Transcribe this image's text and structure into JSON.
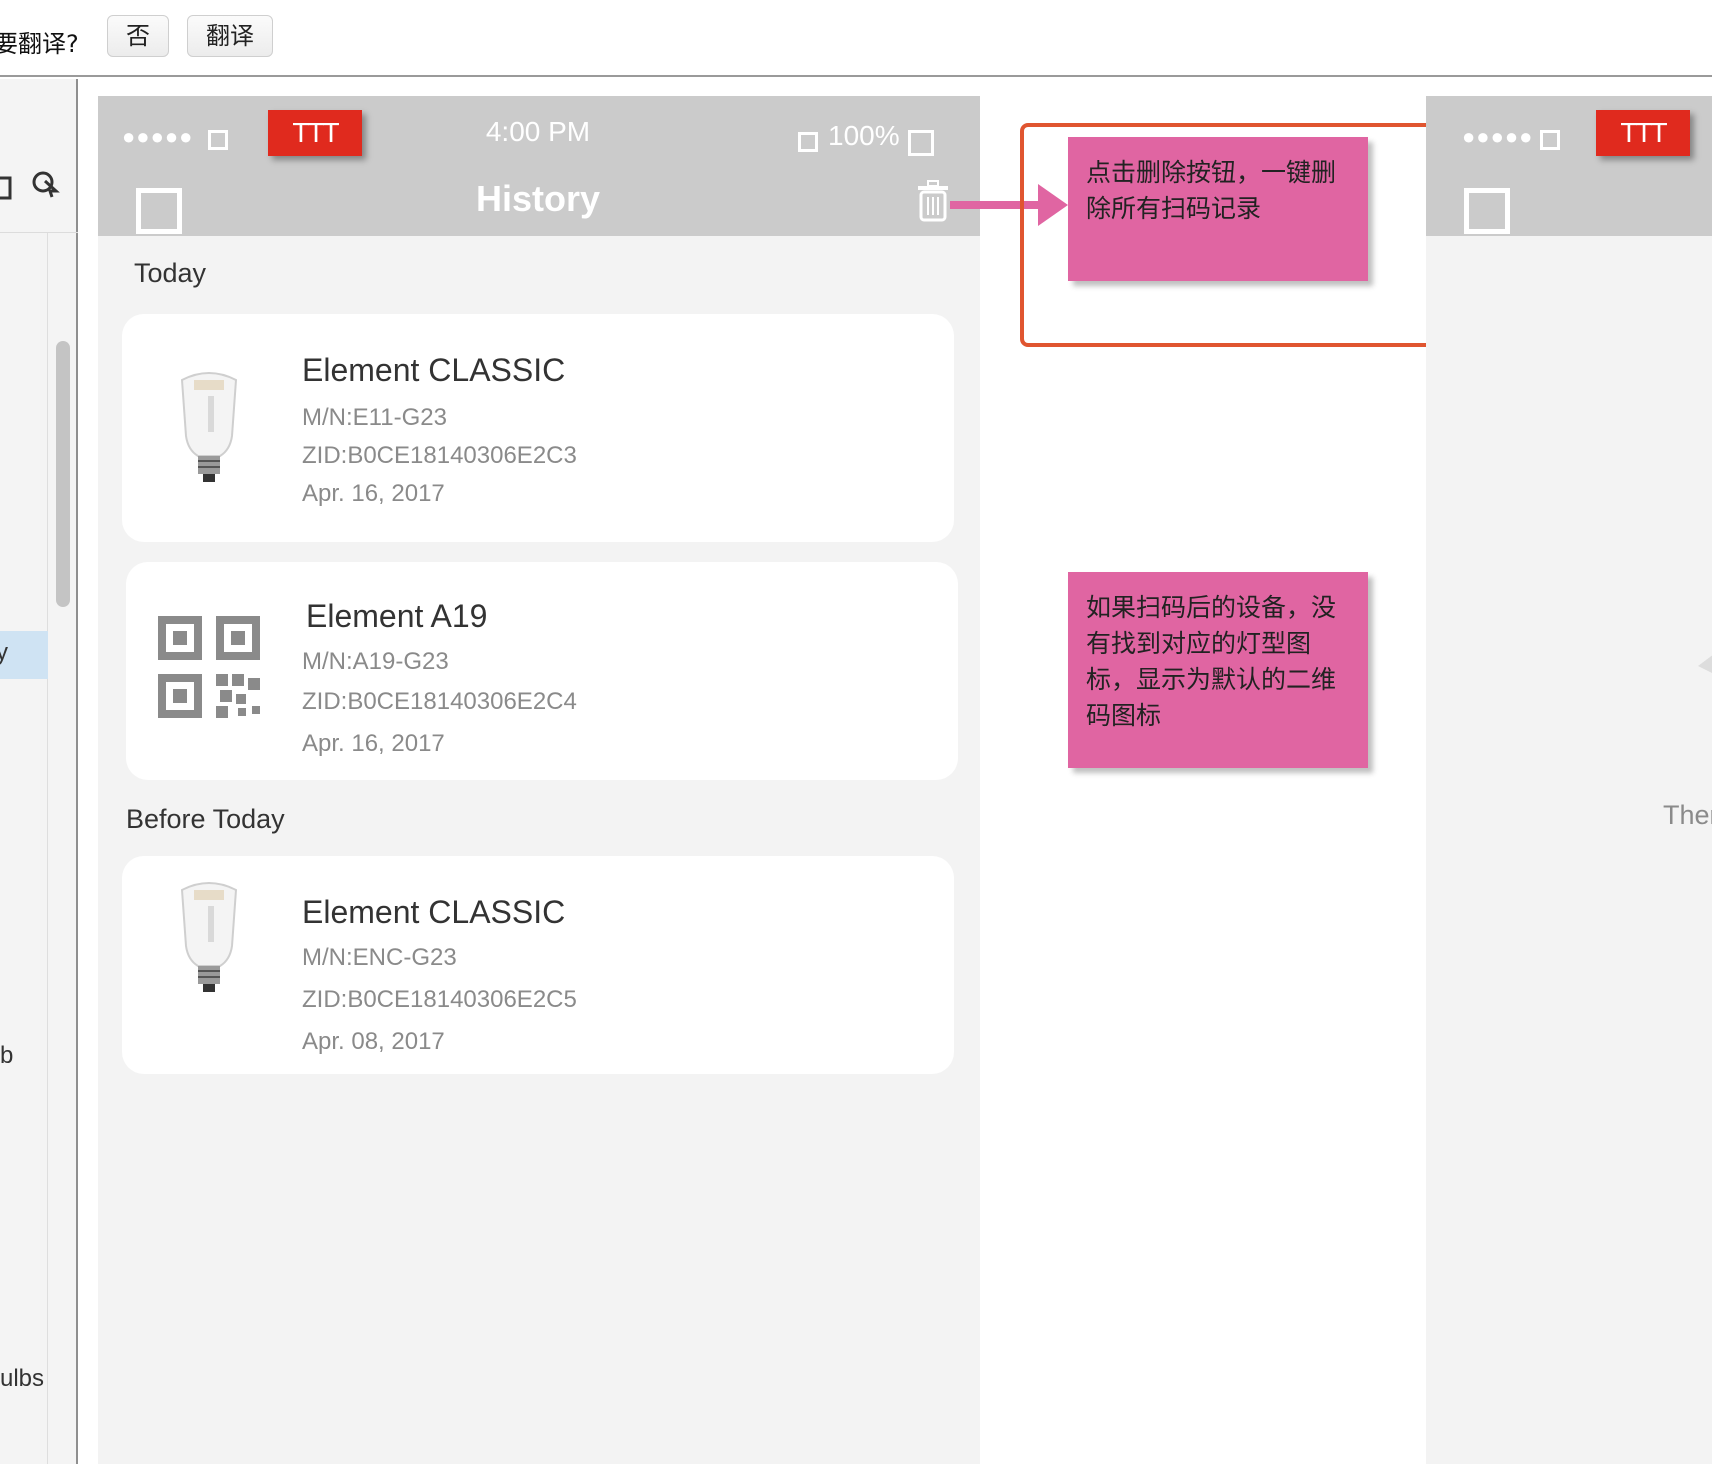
{
  "topbar": {
    "prompt": "要翻译?",
    "no_button": "否",
    "translate_button": "翻译"
  },
  "sidebar": {
    "selected_fragment": "y",
    "fragment_b": "b",
    "fragment_ulbs": "ulbs"
  },
  "phone": {
    "status": {
      "signal": "●●●●●",
      "carrier": "TTT",
      "time": "4:00 PM",
      "battery": "100%"
    },
    "nav_title": "History",
    "sections": [
      {
        "title": "Today",
        "items": [
          {
            "name": "Element CLASSIC",
            "mn": "M/N:E11-G23",
            "zid": "ZID:B0CE18140306E2C3",
            "date": "Apr. 16, 2017",
            "icon": "bulb-icon"
          },
          {
            "name": "Element A19",
            "mn": "M/N:A19-G23",
            "zid": "ZID:B0CE18140306E2C4",
            "date": "Apr. 16, 2017",
            "icon": "qr-code-icon"
          }
        ]
      },
      {
        "title": "Before Today",
        "items": [
          {
            "name": "Element CLASSIC",
            "mn": "M/N:ENC-G23",
            "zid": "ZID:B0CE18140306E2C5",
            "date": "Apr. 08, 2017",
            "icon": "bulb-icon"
          }
        ]
      }
    ]
  },
  "annotations": {
    "delete_note": "点击删除按钮，一键删除所有扫码记录",
    "qr_note": "如果扫码后的设备，没有找到对应的灯型图标，显示为默认的二维码图标"
  },
  "phone2": {
    "carrier": "TTT",
    "signal": "●●●●●",
    "text_fragment": "Ther"
  },
  "colors": {
    "nav_gray": "#cbcbcb",
    "carrier_red": "#e02a1e",
    "note_pink": "#e065a2",
    "highlight_orange": "#e05530"
  }
}
